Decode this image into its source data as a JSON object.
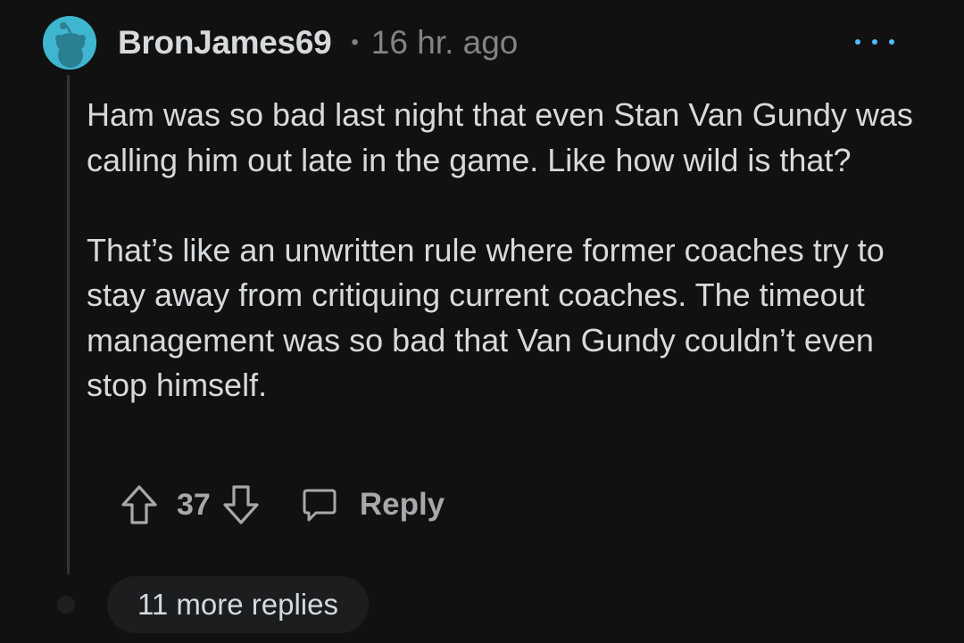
{
  "comment": {
    "author": "BronJames69",
    "separator": "•",
    "timestamp": "16 hr. ago",
    "paragraphs": [
      "Ham was so bad last night that even Stan Van Gundy was calling him out late in the game. Like how wild is that?",
      "That’s like an unwritten rule where former coaches try to stay away from critiquing current coaches. The timeout management was so bad that Van Gundy couldn’t even stop himself."
    ],
    "score": "37",
    "reply_label": "Reply"
  },
  "thread": {
    "more_replies_label": "11 more replies"
  },
  "colors": {
    "background": "#111112",
    "avatar": "#3fb6cf",
    "accent_dots": "#4fbcff",
    "muted_text": "#818384",
    "action_text": "#a6a8ab"
  },
  "icons": {
    "avatar": "snoo-avatar-icon",
    "more": "more-options-icon",
    "upvote": "upvote-arrow-icon",
    "downvote": "downvote-arrow-icon",
    "reply": "comment-bubble-icon"
  }
}
